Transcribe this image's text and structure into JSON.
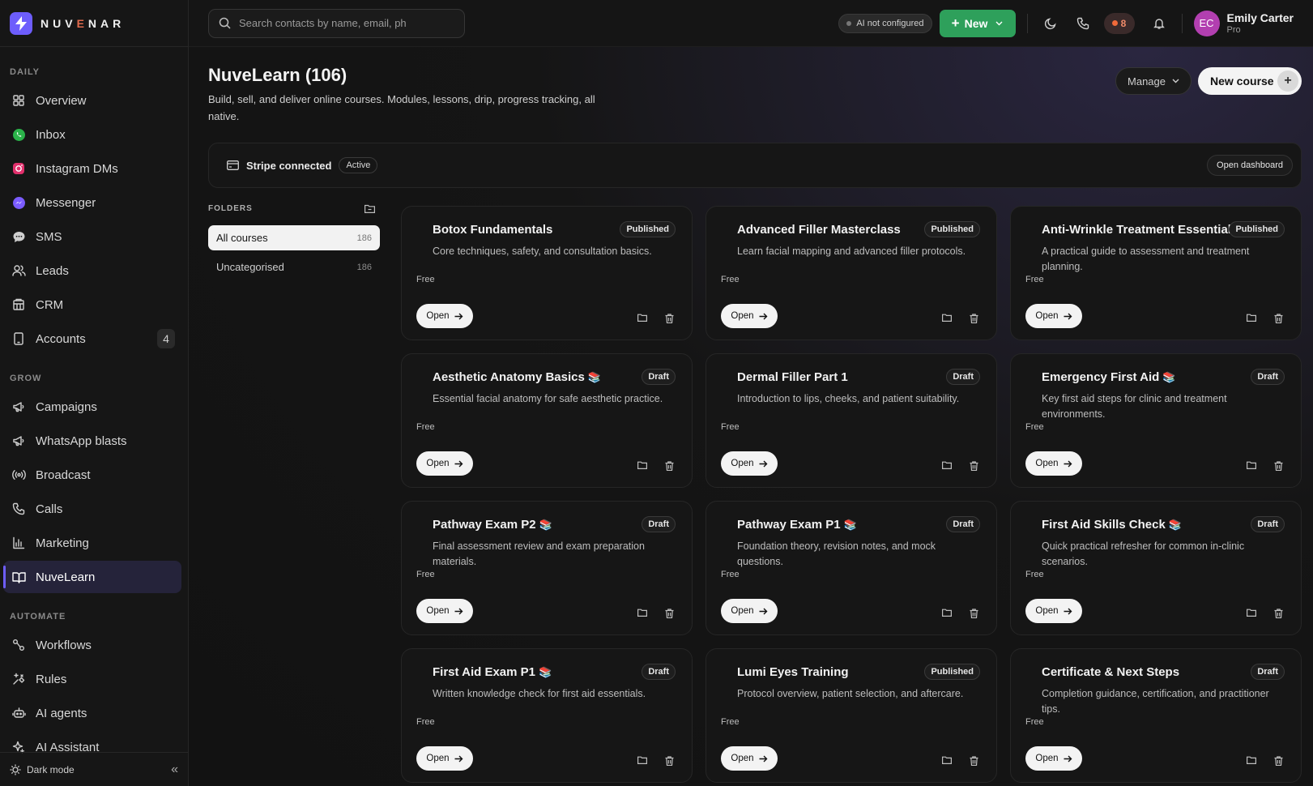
{
  "brand": {
    "name_pre": "NUV",
    "name_accent": "E",
    "name_post": "NAR"
  },
  "sidebar": {
    "sections": [
      {
        "label": "DAILY",
        "items": [
          {
            "label": "Overview",
            "icon": "grid-icon"
          },
          {
            "label": "Inbox",
            "icon": "whatsapp-icon"
          },
          {
            "label": "Instagram DMs",
            "icon": "instagram-icon"
          },
          {
            "label": "Messenger",
            "icon": "messenger-icon"
          },
          {
            "label": "SMS",
            "icon": "sms-icon"
          },
          {
            "label": "Leads",
            "icon": "users-icon"
          },
          {
            "label": "CRM",
            "icon": "building-icon"
          },
          {
            "label": "Accounts",
            "icon": "tablet-icon",
            "badge": "4"
          }
        ]
      },
      {
        "label": "GROW",
        "items": [
          {
            "label": "Campaigns",
            "icon": "megaphone-icon"
          },
          {
            "label": "WhatsApp blasts",
            "icon": "megaphone-icon"
          },
          {
            "label": "Broadcast",
            "icon": "broadcast-icon"
          },
          {
            "label": "Calls",
            "icon": "phone-icon"
          },
          {
            "label": "Marketing",
            "icon": "bar-chart-icon"
          },
          {
            "label": "NuveLearn",
            "icon": "book-icon",
            "active": true
          }
        ]
      },
      {
        "label": "AUTOMATE",
        "items": [
          {
            "label": "Workflows",
            "icon": "workflow-icon"
          },
          {
            "label": "Rules",
            "icon": "rules-icon"
          },
          {
            "label": "AI agents",
            "icon": "bot-icon"
          },
          {
            "label": "AI Assistant",
            "icon": "sparkle-icon"
          }
        ]
      }
    ],
    "footer": {
      "dark_mode_label": "Dark mode"
    }
  },
  "topbar": {
    "search_placeholder": "Search contacts by name, email, ph",
    "ai_status": "AI not configured",
    "new_label": "New",
    "notif_count": "8",
    "user": {
      "initials": "EC",
      "name": "Emily Carter",
      "plan": "Pro"
    },
    "colors": {
      "new_button": "#2ea05b",
      "avatar": "#b23fb0",
      "accent": "#6d5dfc"
    }
  },
  "page": {
    "title": "NuveLearn (106)",
    "subtitle": "Build, sell, and deliver online courses. Modules, lessons, drip, progress tracking, all native.",
    "manage_label": "Manage",
    "new_course_label": "New course"
  },
  "stripe": {
    "label": "Stripe connected",
    "status": "Active",
    "dashboard_label": "Open dashboard"
  },
  "folders": {
    "heading": "FOLDERS",
    "items": [
      {
        "label": "All courses",
        "count": "186",
        "active": true
      },
      {
        "label": "Uncategorised",
        "count": "186"
      }
    ]
  },
  "courses": [
    {
      "title": "Botox Fundamentals",
      "book": false,
      "status": "Published",
      "desc": "Core techniques, safety, and consultation basics.",
      "price": "Free"
    },
    {
      "title": "Advanced Filler Masterclass",
      "book": false,
      "status": "Published",
      "desc": "Learn facial mapping and advanced filler protocols.",
      "price": "Free"
    },
    {
      "title": "Anti-Wrinkle Treatment Essentials",
      "book": false,
      "status": "Published",
      "desc": "A practical guide to assessment and treatment planning.",
      "price": "Free"
    },
    {
      "title": "Aesthetic Anatomy Basics",
      "book": true,
      "status": "Draft",
      "desc": "Essential facial anatomy for safe aesthetic practice.",
      "price": "Free"
    },
    {
      "title": "Dermal Filler Part 1",
      "book": false,
      "status": "Draft",
      "desc": "Introduction to lips, cheeks, and patient suitability.",
      "price": "Free"
    },
    {
      "title": "Emergency First Aid",
      "book": true,
      "status": "Draft",
      "desc": "Key first aid steps for clinic and treatment environments.",
      "price": "Free"
    },
    {
      "title": "Pathway Exam P2",
      "book": true,
      "status": "Draft",
      "desc": "Final assessment review and exam preparation materials.",
      "price": "Free"
    },
    {
      "title": "Pathway Exam P1",
      "book": true,
      "status": "Draft",
      "desc": "Foundation theory, revision notes, and mock questions.",
      "price": "Free"
    },
    {
      "title": "First Aid Skills Check",
      "book": true,
      "status": "Draft",
      "desc": "Quick practical refresher for common in-clinic scenarios.",
      "price": "Free"
    },
    {
      "title": "First Aid Exam P1",
      "book": true,
      "status": "Draft",
      "desc": "Written knowledge check for first aid essentials.",
      "price": "Free"
    },
    {
      "title": "Lumi Eyes Training",
      "book": false,
      "status": "Published",
      "desc": "Protocol overview, patient selection, and aftercare.",
      "price": "Free"
    },
    {
      "title": "Certificate & Next Steps",
      "book": false,
      "status": "Draft",
      "desc": "Completion guidance, certification, and practitioner tips.",
      "price": "Free"
    }
  ],
  "card_labels": {
    "open": "Open",
    "book_glyph": "📚"
  }
}
